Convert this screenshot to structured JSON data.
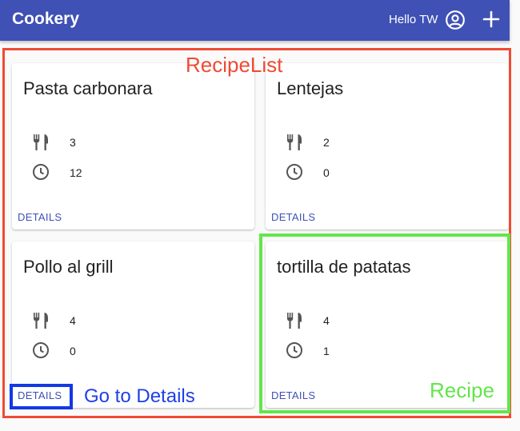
{
  "app_bar": {
    "title": "Cookery",
    "greeting": "Hello TW",
    "color": "#3f51b5"
  },
  "recipes": [
    {
      "name": "Pasta carbonara",
      "servings": "3",
      "time": "12",
      "details_label": "DETAILS"
    },
    {
      "name": "Lentejas",
      "servings": "2",
      "time": "0",
      "details_label": "DETAILS"
    },
    {
      "name": "Pollo al grill",
      "servings": "4",
      "time": "0",
      "details_label": "DETAILS"
    },
    {
      "name": "tortilla de patatas",
      "servings": "4",
      "time": "1",
      "details_label": "DETAILS"
    }
  ],
  "annotations": {
    "recipe_list": "RecipeList",
    "go_to_details": "Go to Details",
    "recipe": "Recipe",
    "colors": {
      "red": "#f04a34",
      "blue": "#1239e5",
      "green": "#62e64a"
    }
  },
  "icons": {
    "servings": "fork-knife-icon",
    "time": "clock-icon",
    "account": "account-circle-icon",
    "add": "add-icon"
  }
}
